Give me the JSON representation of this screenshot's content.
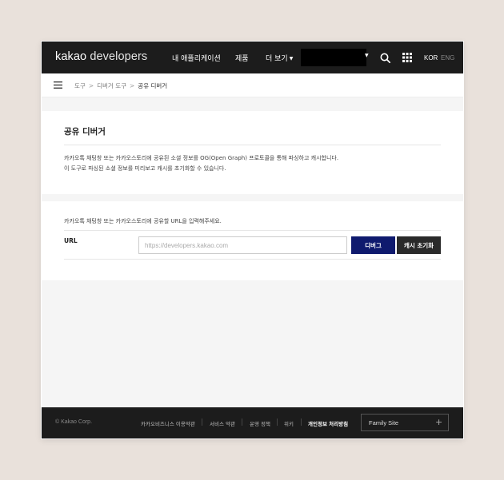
{
  "header": {
    "logo_bold": "kakao",
    "logo_light": "developers",
    "nav": [
      "내 애플리케이션",
      "제품",
      "더 보기"
    ],
    "lang": [
      "KOR",
      "ENG"
    ]
  },
  "breadcrumb": {
    "items": [
      "도구",
      "디버거 도구",
      "공유 디버거"
    ],
    "separator": ">"
  },
  "main": {
    "title": "공유 디버거",
    "desc_lines": [
      "카카오톡 채팅창 또는 카카오스토리에 공유된 소셜 정보를 OG(Open Graph) 프로토콜을 통해 파싱하고 캐시합니다.",
      "이 도구로 파싱된 소셜 정보를 미리보고 캐시를 초기화할 수 있습니다."
    ]
  },
  "form": {
    "instruction": "카카오톡 채팅창 또는 카카오스토리에 공유할 URL을 입력해주세요.",
    "url_label": "URL",
    "url_placeholder": "https://developers.kakao.com",
    "url_value": "",
    "debug_button": "디버그",
    "cache_reset_button": "캐시 초기화"
  },
  "footer": {
    "copyright": "© Kakao Corp.",
    "links": [
      "카카오비즈니스 이용약관",
      "서비스 약관",
      "운영 정책",
      "위키",
      "개인정보 처리방침"
    ],
    "family_site": "Family Site",
    "family_plus": "+"
  },
  "icons": {
    "search": "search-icon",
    "apps": "apps-grid-icon",
    "menu": "hamburger-menu-icon"
  },
  "colors": {
    "topbar": "#1c1c1c",
    "debug_button": "#0f1a6e",
    "cache_button": "#2a2a2a"
  }
}
